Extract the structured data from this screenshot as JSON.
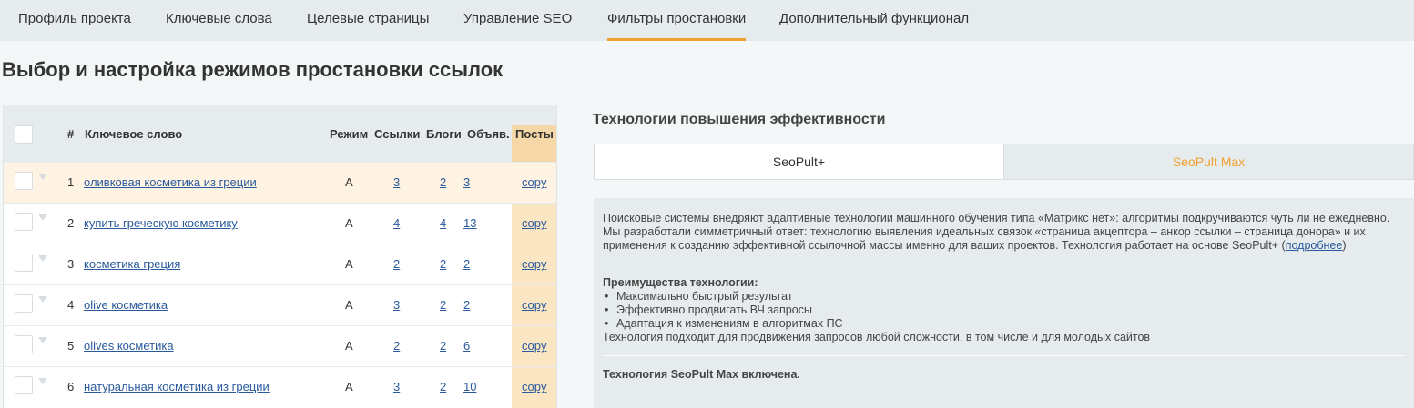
{
  "nav": {
    "tabs": [
      {
        "label": "Профиль проекта",
        "active": false
      },
      {
        "label": "Ключевые слова",
        "active": false
      },
      {
        "label": "Целевые страницы",
        "active": false
      },
      {
        "label": "Управление SEO",
        "active": false
      },
      {
        "label": "Фильтры простановки",
        "active": true
      },
      {
        "label": "Дополнительный функционал",
        "active": false
      }
    ]
  },
  "page": {
    "title": "Выбор и настройка режимов простановки ссылок"
  },
  "table": {
    "headers": {
      "num": "#",
      "keyword": "Ключевое слово",
      "mode": "Режим",
      "links": "Ссылки",
      "blogs": "Блоги",
      "ads": "Объяв.",
      "posts": "Посты"
    },
    "rows": [
      {
        "num": "1",
        "keyword": "оливковая косметика из греции",
        "mode": "A",
        "links": "3",
        "blogs": "2",
        "ads": "3",
        "posts": "copy"
      },
      {
        "num": "2",
        "keyword": "купить греческую косметику",
        "mode": "A",
        "links": "4",
        "blogs": "4",
        "ads": "13",
        "posts": "copy"
      },
      {
        "num": "3",
        "keyword": "косметика греция",
        "mode": "A",
        "links": "2",
        "blogs": "2",
        "ads": "2",
        "posts": "copy"
      },
      {
        "num": "4",
        "keyword": "olive косметика",
        "mode": "A",
        "links": "3",
        "blogs": "2",
        "ads": "2",
        "posts": "copy"
      },
      {
        "num": "5",
        "keyword": "olives косметика",
        "mode": "A",
        "links": "2",
        "blogs": "2",
        "ads": "6",
        "posts": "copy"
      },
      {
        "num": "6",
        "keyword": "натуральная косметика из греции",
        "mode": "A",
        "links": "3",
        "blogs": "2",
        "ads": "10",
        "posts": "copy"
      }
    ]
  },
  "tech": {
    "title": "Технологии повышения эффективности",
    "options": [
      "SeoPult+",
      "SeoPult Max"
    ],
    "selected": "SeoPult Max",
    "description": "Поисковые системы внедряют адаптивные технологии машинного обучения типа «Матрикс нет»: алгоритмы подкручиваются чуть ли не ежедневно. Мы разработали симметричный ответ: технологию выявления идеальных связок «страница акцептора – анкор ссылки – страница донора» и их применения к созданию эффективной ссылочной массы именно для ваших проектов. Технология работает на основе SeoPult+",
    "more_link": "подробнее",
    "advantages_title": "Преимущества технологии:",
    "advantages": [
      "Максимально быстрый результат",
      "Эффективно продвигать ВЧ запросы",
      "Адаптация к изменениям в алгоритмах ПС"
    ],
    "suitability": "Технология подходит для продвижения запросов любой сложности, в том числе и для молодых сайтов",
    "status": "Технология SeoPult Max включена."
  },
  "colors": {
    "accent": "#f0a030",
    "link": "#2a5a9c",
    "header_bg": "#e6ecee",
    "posts_col": "#fbe6c4",
    "row_highlight": "#fff3e3"
  }
}
